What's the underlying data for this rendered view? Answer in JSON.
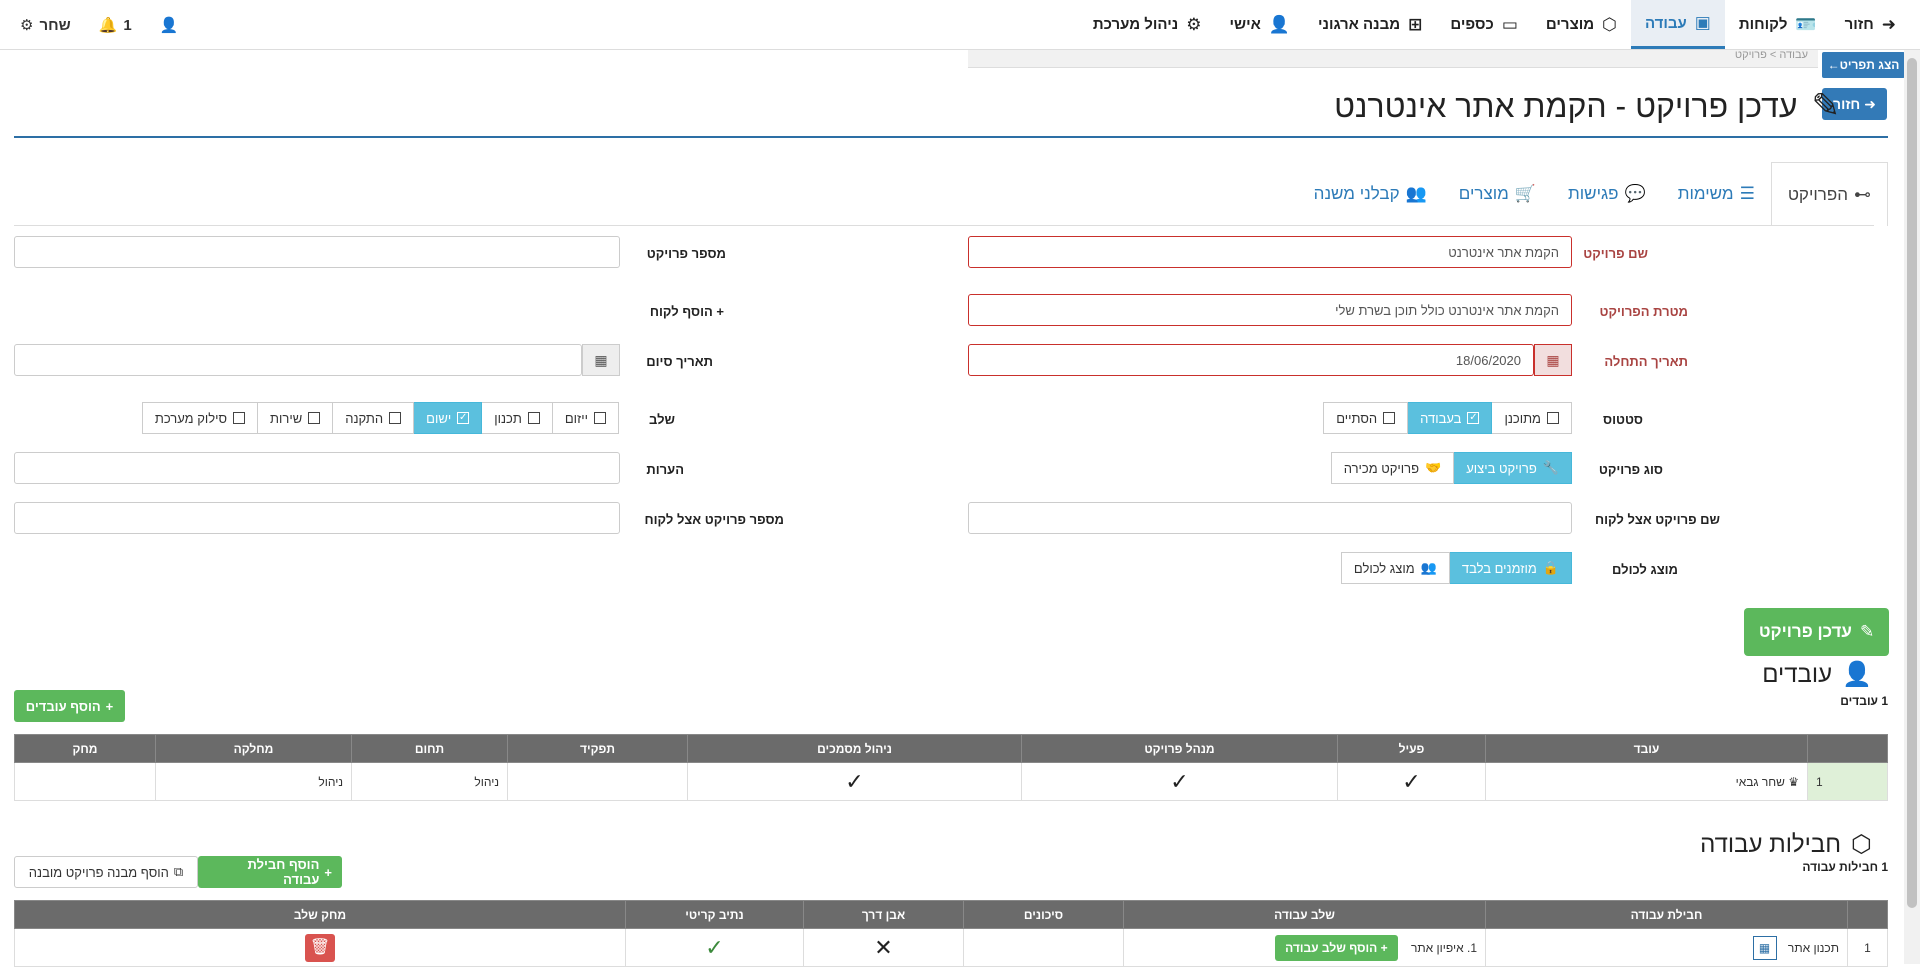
{
  "nav": {
    "items": [
      {
        "label": "חזור",
        "icon": "arrow-right-icon"
      },
      {
        "label": "לקוחות",
        "icon": "id-card-icon"
      },
      {
        "label": "עבודה",
        "icon": "laptop-code-icon",
        "active": true
      },
      {
        "label": "מוצרים",
        "icon": "cubes-icon"
      },
      {
        "label": "כספים",
        "icon": "money-bill-icon"
      },
      {
        "label": "מבנה ארגוני",
        "icon": "sitemap-icon"
      },
      {
        "label": "אישי",
        "icon": "user-shield-icon"
      },
      {
        "label": "ניהול מערכת",
        "icon": "cogs-icon"
      }
    ],
    "user_name": "שחר",
    "notifications_count": "1"
  },
  "breadcrumb": {
    "text": "עבודה > פרויקט"
  },
  "buttons": {
    "show_params": "הצג תפריט←",
    "back": "חזור"
  },
  "page_title": "עדכן פרויקט - הקמת אתר אינטרנט",
  "tabs": [
    {
      "label": "הפרויקט",
      "icon": "project-diagram-icon"
    },
    {
      "label": "משימות",
      "icon": "tasks-icon"
    },
    {
      "label": "פגישות",
      "icon": "comments-icon"
    },
    {
      "label": "מוצרים",
      "icon": "cart-arrow-down-icon"
    },
    {
      "label": "קבלני משנה",
      "icon": "users-cog-icon"
    }
  ],
  "form": {
    "project_name_label": "שם פרויקט",
    "project_name_value": "הקמת אתר אינטרנט",
    "project_number_label": "מספר פרויקט",
    "project_goal_label": "מטרת הפרויקט",
    "project_goal_value": "הקמת אתר אינטרנט כולל תוכן בשרת שלי",
    "add_client_label": "הוסף לקוח",
    "start_date_label": "תאריך התחלה",
    "start_date_value": "18/06/2020",
    "end_date_label": "תאריך סיום",
    "status_label": "סטטוס",
    "status_options": [
      {
        "label": "מתוכנן",
        "on": false
      },
      {
        "label": "בעבודה",
        "on": true
      },
      {
        "label": "הסתיים",
        "on": false
      }
    ],
    "stage_label": "שלב",
    "stage_options": [
      {
        "label": "ייזום",
        "on": false
      },
      {
        "label": "תכנון",
        "on": false
      },
      {
        "label": "ישום",
        "on": true
      },
      {
        "label": "התקנה",
        "on": false
      },
      {
        "label": "שירות",
        "on": false
      },
      {
        "label": "סילוק מערכת",
        "on": false
      }
    ],
    "project_type_label": "סוג פרויקט",
    "project_type_options": [
      {
        "label": "פרויקט ביצוע",
        "on": true
      },
      {
        "label": "פרויקט מכירה",
        "on": false
      }
    ],
    "notes_label": "הערות",
    "client_project_name_label": "שם פרויקט אצל לקוח",
    "client_project_number_label": "מספר פרויקט אצל לקוח",
    "visible_label": "מוצג לכולם",
    "visible_options": [
      {
        "label": "מוזמנים בלבד",
        "on": true
      },
      {
        "label": "מוצג לכולם",
        "on": false
      }
    ],
    "save_button": "עדכן פרויקט"
  },
  "workers": {
    "title": "עובדים",
    "subtitle": "1 עובדים",
    "add_button": "הוסף עובדים",
    "columns": [
      "עובד",
      "פעיל",
      "מנהל פרויקט",
      "ניהול מסמכים",
      "תפקיד",
      "תחום",
      "מחלקה",
      "מחק"
    ],
    "rows": [
      {
        "num": "1",
        "name": "שחר גבאי",
        "active": "✓",
        "manager": "✓",
        "docs": "✓",
        "role": "",
        "field": "ניהול",
        "dept": "ניהול",
        "delete": ""
      }
    ]
  },
  "packages": {
    "title": "חבילות עבודה",
    "subtitle": "1 חבילות עבודה",
    "add_package_button": "הוסף חבילת עבודה",
    "add_structure_button": "הוסף מבנה פרויקט מובנה",
    "columns": [
      "חבילת עבודה",
      "שלב עבודה",
      "סיכונים",
      "אבן דרך",
      "נתיב קריטי",
      "מחק שלב"
    ],
    "rows": [
      {
        "num": "1",
        "name": "תכנון אתר",
        "add_stage": "הוסף שלב עבודה",
        "stage": "1. איפיון אתר",
        "risks": "",
        "milestone": "✕",
        "critical": "✓"
      }
    ]
  }
}
